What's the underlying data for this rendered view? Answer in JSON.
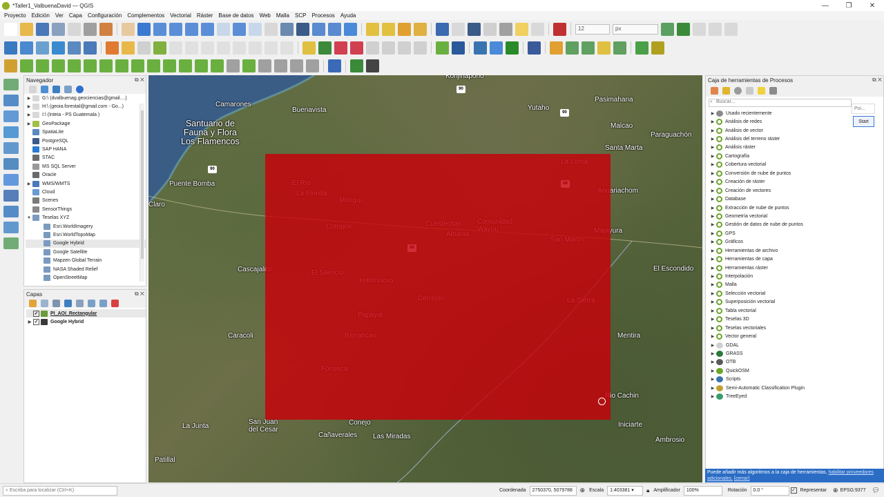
{
  "window": {
    "title": "*Taller1_ValbuenaDavid — QGIS",
    "controls": [
      "—",
      "❐",
      "✕"
    ]
  },
  "menu": [
    "Proyecto",
    "Edición",
    "Ver",
    "Capa",
    "Configuración",
    "Complementos",
    "Vectorial",
    "Ráster",
    "Base de datos",
    "Web",
    "Malla",
    "SCP",
    "Procesos",
    "Ayuda"
  ],
  "toolbar": {
    "font_size": "12",
    "unit": "px"
  },
  "navigator": {
    "title": "Navegador",
    "items": [
      {
        "label": "G:\\ (dvalbuenag.geociencias@gmail....)",
        "expand": true,
        "icon": "drive-icon",
        "indent": 0
      },
      {
        "label": "H:\\ (geoia.forestal@gmail.com - Go...)",
        "expand": true,
        "icon": "drive-icon",
        "indent": 0
      },
      {
        "label": "I:\\ (Inteia - PS Guatemala )",
        "expand": true,
        "icon": "drive-icon",
        "indent": 0
      },
      {
        "label": "GeoPackage",
        "expand": true,
        "icon": "geopackage-icon",
        "indent": 0
      },
      {
        "label": "SpatiaLite",
        "expand": false,
        "icon": "spatialite-icon",
        "indent": 0
      },
      {
        "label": "PostgreSQL",
        "expand": false,
        "icon": "postgresql-icon",
        "indent": 0
      },
      {
        "label": "SAP HANA",
        "expand": false,
        "icon": "sap-hana-icon",
        "indent": 0
      },
      {
        "label": "STAC",
        "expand": false,
        "icon": "stac-icon",
        "indent": 0
      },
      {
        "label": "MS SQL Server",
        "expand": false,
        "icon": "mssql-icon",
        "indent": 0
      },
      {
        "label": "Oracle",
        "expand": false,
        "icon": "oracle-icon",
        "indent": 0
      },
      {
        "label": "WMS/WMTS",
        "expand": true,
        "icon": "wms-icon",
        "indent": 0
      },
      {
        "label": "Cloud",
        "expand": false,
        "icon": "cloud-icon",
        "indent": 0
      },
      {
        "label": "Scenes",
        "expand": false,
        "icon": "scenes-icon",
        "indent": 0
      },
      {
        "label": "SensorThings",
        "expand": false,
        "icon": "sensorthings-icon",
        "indent": 0
      },
      {
        "label": "Teselas XYZ",
        "expand": "open",
        "icon": "xyz-tiles-icon",
        "indent": 0
      },
      {
        "label": "Esri.WorldImagery",
        "expand": false,
        "icon": "xyz-tiles-icon",
        "indent": 1
      },
      {
        "label": "Esri.WorldTopoMap",
        "expand": false,
        "icon": "xyz-tiles-icon",
        "indent": 1
      },
      {
        "label": "Google Hybrid",
        "expand": false,
        "icon": "xyz-tiles-icon",
        "indent": 1,
        "selected": true
      },
      {
        "label": "Google Satellite",
        "expand": false,
        "icon": "xyz-tiles-icon",
        "indent": 1
      },
      {
        "label": "Mapzen Global Terrain",
        "expand": false,
        "icon": "xyz-tiles-icon",
        "indent": 1
      },
      {
        "label": "NASA Shaded Relief",
        "expand": false,
        "icon": "xyz-tiles-icon",
        "indent": 1
      },
      {
        "label": "OpenStreetMap",
        "expand": false,
        "icon": "xyz-tiles-icon",
        "indent": 1
      }
    ]
  },
  "layers": {
    "title": "Capas",
    "items": [
      {
        "label": "PI_AOI_Rectangular",
        "checked": true
      },
      {
        "label": "Google Hybrid",
        "checked": true
      }
    ]
  },
  "map": {
    "places": [
      {
        "label": "Kohjinapono",
        "style": "normal"
      },
      {
        "label": "Camarones",
        "style": "normal"
      },
      {
        "label": "Buenavista",
        "style": "normal"
      },
      {
        "label": "Yutaho",
        "style": "normal"
      },
      {
        "label": "Pasimahana",
        "style": "normal"
      },
      {
        "label": "Santuario de\nFauna y Flora\nLos Flamencos",
        "style": "big"
      },
      {
        "label": "Malcao",
        "style": "normal"
      },
      {
        "label": "Paraguachón",
        "style": "normal"
      },
      {
        "label": "Santa Marta",
        "style": "normal"
      },
      {
        "label": "Puente Bomba",
        "style": "normal"
      },
      {
        "label": "La Loma",
        "style": "normal"
      },
      {
        "label": "El Rio",
        "style": "normal"
      },
      {
        "label": "La Florida",
        "style": "normal"
      },
      {
        "label": "Mongui",
        "style": "normal"
      },
      {
        "label": "Anuariachom",
        "style": "normal"
      },
      {
        "label": "Claro",
        "style": "normal"
      },
      {
        "label": "Cotoprix",
        "style": "normal"
      },
      {
        "label": "Cuestecitas",
        "style": "normal"
      },
      {
        "label": "Comunidad\nWayuu",
        "style": "normal"
      },
      {
        "label": "Albania",
        "style": "normal"
      },
      {
        "label": "Majayura",
        "style": "normal"
      },
      {
        "label": "San Martin",
        "style": "normal"
      },
      {
        "label": "Cascajalito",
        "style": "normal"
      },
      {
        "label": "El Silencio",
        "style": "normal"
      },
      {
        "label": "El Escondido",
        "style": "normal"
      },
      {
        "label": "Hatonuevo",
        "style": "normal"
      },
      {
        "label": "Cerrejón",
        "style": "normal"
      },
      {
        "label": "La Sierra",
        "style": "normal"
      },
      {
        "label": "Papayal",
        "style": "normal"
      },
      {
        "label": "Caracoli",
        "style": "normal"
      },
      {
        "label": "Barrancas",
        "style": "normal"
      },
      {
        "label": "Mentira",
        "style": "normal"
      },
      {
        "label": "Fonseca",
        "style": "normal"
      },
      {
        "label": "Rio Cachin",
        "style": "normal"
      },
      {
        "label": "La Junta",
        "style": "normal"
      },
      {
        "label": "San Juan\ndel Cesar",
        "style": "normal"
      },
      {
        "label": "Conejo",
        "style": "normal"
      },
      {
        "label": "Iniciarte",
        "style": "normal"
      },
      {
        "label": "Cañaverales",
        "style": "normal"
      },
      {
        "label": "Las Miradas",
        "style": "normal"
      },
      {
        "label": "Ambrosio",
        "style": "normal"
      },
      {
        "label": "Patillal",
        "style": "normal"
      }
    ],
    "routes": [
      "90",
      "90",
      "90",
      "88",
      "88"
    ],
    "aoi_color": "#c8000a"
  },
  "processing": {
    "title": "Caja de herramientas de Procesos",
    "search_placeholder": "Buscar...",
    "poi_label": "Poi...",
    "start_label": "Start",
    "items": [
      {
        "label": "Usado recientemente",
        "icon": "clock-icon"
      },
      {
        "label": "Análisis de redes",
        "icon": "qgis-icon"
      },
      {
        "label": "Análisis de vector",
        "icon": "qgis-icon"
      },
      {
        "label": "Análisis del terreno ráster",
        "icon": "qgis-icon"
      },
      {
        "label": "Análisis ráster",
        "icon": "qgis-icon"
      },
      {
        "label": "Cartografía",
        "icon": "qgis-icon"
      },
      {
        "label": "Cobertura vectorial",
        "icon": "qgis-icon"
      },
      {
        "label": "Conversión de nube de puntos",
        "icon": "qgis-icon"
      },
      {
        "label": "Creación de ráster",
        "icon": "qgis-icon"
      },
      {
        "label": "Creación de vectores",
        "icon": "qgis-icon"
      },
      {
        "label": "Database",
        "icon": "qgis-icon"
      },
      {
        "label": "Extracción de nube de puntos",
        "icon": "qgis-icon"
      },
      {
        "label": "Geometría vectorial",
        "icon": "qgis-icon"
      },
      {
        "label": "Gestión de datos de nube de puntos",
        "icon": "qgis-icon"
      },
      {
        "label": "GPS",
        "icon": "qgis-icon"
      },
      {
        "label": "Gráficos",
        "icon": "qgis-icon"
      },
      {
        "label": "Herramientas de archivo",
        "icon": "qgis-icon"
      },
      {
        "label": "Herramientas de capa",
        "icon": "qgis-icon"
      },
      {
        "label": "Herramientas ráster",
        "icon": "qgis-icon"
      },
      {
        "label": "Interpolación",
        "icon": "qgis-icon"
      },
      {
        "label": "Malla",
        "icon": "qgis-icon"
      },
      {
        "label": "Selección vectorial",
        "icon": "qgis-icon"
      },
      {
        "label": "Superposición vectorial",
        "icon": "qgis-icon"
      },
      {
        "label": "Tabla vectorial",
        "icon": "qgis-icon"
      },
      {
        "label": "Teselas 3D",
        "icon": "qgis-icon"
      },
      {
        "label": "Teselas vectoriales",
        "icon": "qgis-icon"
      },
      {
        "label": "Vector general",
        "icon": "qgis-icon"
      },
      {
        "label": "GDAL",
        "icon": "gdal-icon"
      },
      {
        "label": "GRASS",
        "icon": "grass-icon"
      },
      {
        "label": "OTB",
        "icon": "otb-icon"
      },
      {
        "label": "QuickOSM",
        "icon": "quickosm-icon"
      },
      {
        "label": "Scripts",
        "icon": "python-icon"
      },
      {
        "label": "Semi-Automatic Classification Plugin",
        "icon": "scp-icon"
      },
      {
        "label": "TreeEyed",
        "icon": "treeeyed-icon"
      }
    ],
    "notice_text": "Puede añadir más algoritmos a la caja de herramientas,",
    "notice_link": "habilitar proveedores adicionales.",
    "notice_close": "[cerrar]"
  },
  "statusbar": {
    "locate_placeholder": "Escriba para localizar (Ctrl+K)",
    "coord_label": "Coordenada",
    "coord_value": "2750370, 5079788",
    "scale_label": "Escala",
    "scale_value": "1:403381",
    "magnifier_label": "Amplificador",
    "magnifier_value": "100%",
    "rotation_label": "Rotación",
    "rotation_value": "0.0 °",
    "render_label": "Representar",
    "crs_value": "EPSG:9377"
  }
}
